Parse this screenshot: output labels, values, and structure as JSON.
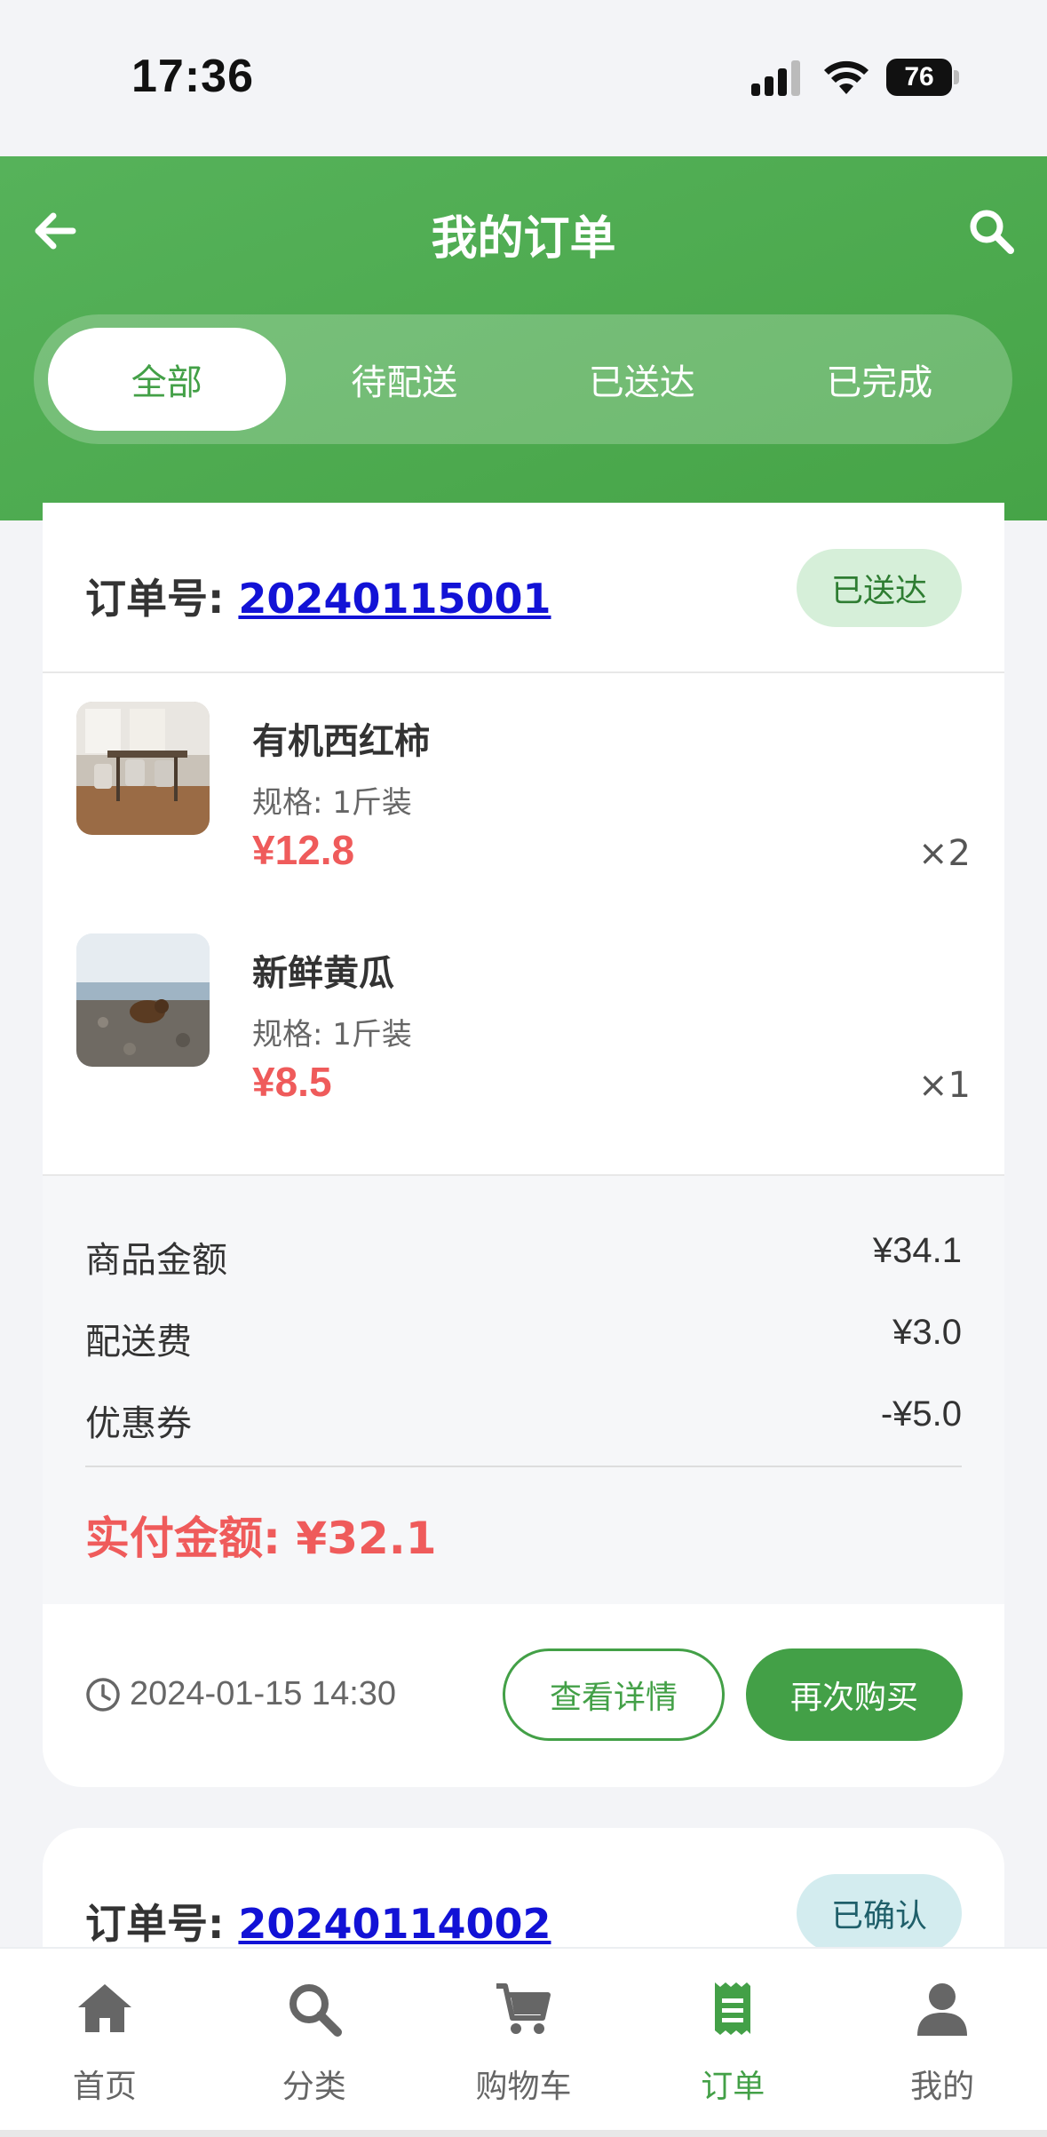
{
  "status_bar": {
    "time": "17:36",
    "battery": "76"
  },
  "header": {
    "title": "我的订单",
    "tabs": [
      {
        "label": "全部",
        "active": true
      },
      {
        "label": "待配送",
        "active": false
      },
      {
        "label": "已送达",
        "active": false
      },
      {
        "label": "已完成",
        "active": false
      }
    ]
  },
  "orders": [
    {
      "order_label": "订单号: ",
      "order_no": "20240115001",
      "status": "已送达",
      "items": [
        {
          "name": "有机西红柿",
          "spec": "规格: 1斤装",
          "price": "¥12.8",
          "qty": "×2"
        },
        {
          "name": "新鲜黄瓜",
          "spec": "规格: 1斤装",
          "price": "¥8.5",
          "qty": "×1"
        }
      ],
      "summary": {
        "goods_label": "商品金额",
        "goods_value": "¥34.1",
        "delivery_label": "配送费",
        "delivery_value": "¥3.0",
        "coupon_label": "优惠券",
        "coupon_value": "-¥5.0",
        "paid": "实付金额: ¥32.1"
      },
      "time": "2024-01-15 14:30",
      "detail_button": "查看详情",
      "rebuy_button": "再次购买"
    },
    {
      "order_label": "订单号: ",
      "order_no": "20240114002",
      "status": "已确认"
    }
  ],
  "bottom_nav": [
    {
      "label": "首页",
      "icon": "home-icon",
      "active": false
    },
    {
      "label": "分类",
      "icon": "search-icon",
      "active": false
    },
    {
      "label": "购物车",
      "icon": "cart-icon",
      "active": false
    },
    {
      "label": "订单",
      "icon": "receipt-icon",
      "active": true
    },
    {
      "label": "我的",
      "icon": "user-icon",
      "active": false
    }
  ],
  "colors": {
    "primary": "#43a047",
    "price": "#ef5b5b",
    "link": "#1212d6"
  }
}
